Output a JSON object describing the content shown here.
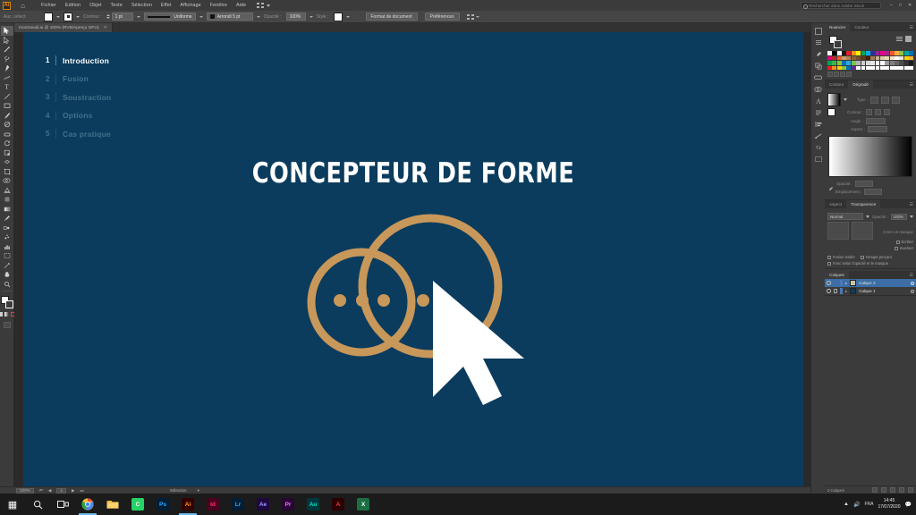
{
  "app": {
    "name": "Adobe Illustrator",
    "logo_text": "Ai"
  },
  "menubar": {
    "home_icon": "home-icon",
    "items": [
      "Fichier",
      "Edition",
      "Objet",
      "Texte",
      "Sélection",
      "Effet",
      "Affichage",
      "Fenêtre",
      "Aide"
    ],
    "arrange_icon": "grid-icon",
    "search_placeholder": "Rechercher dans Adobe Stock",
    "window_minimize": "–",
    "window_maximize": "□",
    "window_close": "✕"
  },
  "controlbar": {
    "selection_label": "Auc. sélect.",
    "fill_label": "fill-swatch",
    "stroke_label": "stroke-swatch",
    "stroke_name_label": "Contour :",
    "stroke_weight": "1 pt",
    "stroke_profile": "Uniforme",
    "brush_definition": "Arrondi 5 pt",
    "opacity_label": "Opacité :",
    "opacity_value": "100%",
    "style_label": "Style :",
    "document_setup": "Format de document",
    "preferences": "Préférences",
    "align_icon": "align-icon"
  },
  "document_tab": {
    "title": "montravail.ai @ 100% (RVB/Aperçu GPU)",
    "close_icon": "close-icon"
  },
  "toolbar": {
    "tools": [
      {
        "name": "selection-tool",
        "glyph": "➤",
        "selected": true
      },
      {
        "name": "direct-selection-tool",
        "glyph": "➤",
        "selected": false
      },
      {
        "name": "magic-wand-tool",
        "glyph": "✦",
        "selected": false
      },
      {
        "name": "lasso-tool",
        "glyph": "❀",
        "selected": false
      },
      {
        "name": "pen-tool",
        "glyph": "✒",
        "selected": false
      },
      {
        "name": "curvature-tool",
        "glyph": "∿",
        "selected": false
      },
      {
        "name": "type-tool",
        "glyph": "T",
        "selected": false
      },
      {
        "name": "line-segment-tool",
        "glyph": "╱",
        "selected": false
      },
      {
        "name": "rectangle-tool",
        "glyph": "□",
        "selected": false
      },
      {
        "name": "paintbrush-tool",
        "glyph": "✐",
        "selected": false
      },
      {
        "name": "shaper-tool",
        "glyph": "◔",
        "selected": false
      },
      {
        "name": "eraser-tool",
        "glyph": "▭",
        "selected": false
      },
      {
        "name": "rotate-tool",
        "glyph": "↻",
        "selected": false
      },
      {
        "name": "scale-tool",
        "glyph": "⤡",
        "selected": false
      },
      {
        "name": "width-tool",
        "glyph": "⦸",
        "selected": false
      },
      {
        "name": "free-transform-tool",
        "glyph": "▦",
        "selected": false
      },
      {
        "name": "shape-builder-tool",
        "glyph": "◍",
        "selected": false
      },
      {
        "name": "perspective-grid-tool",
        "glyph": "◱",
        "selected": false
      },
      {
        "name": "mesh-tool",
        "glyph": "⌗",
        "selected": false
      },
      {
        "name": "gradient-tool",
        "glyph": "▧",
        "selected": false
      },
      {
        "name": "eyedropper-tool",
        "glyph": "⚗",
        "selected": false
      },
      {
        "name": "blend-tool",
        "glyph": "⧉",
        "selected": false
      },
      {
        "name": "symbol-sprayer-tool",
        "glyph": "⁂",
        "selected": false
      },
      {
        "name": "column-graph-tool",
        "glyph": "█",
        "selected": false
      },
      {
        "name": "artboard-tool",
        "glyph": "⬚",
        "selected": false
      },
      {
        "name": "slice-tool",
        "glyph": "✄",
        "selected": false
      },
      {
        "name": "hand-tool",
        "glyph": "✋",
        "selected": false
      },
      {
        "name": "zoom-tool",
        "glyph": "⚲",
        "selected": false
      }
    ],
    "fill_color": "#ffffff",
    "stroke_color": "#ffffff"
  },
  "slide": {
    "background_color": "#0b3c5d",
    "accent_color": "#c8975a",
    "dim_color": "#44708c",
    "title": "CONCEPTEUR DE FORME",
    "outline": [
      {
        "number": "1",
        "label": "Introduction",
        "active": true
      },
      {
        "number": "2",
        "label": "Fusion",
        "active": false
      },
      {
        "number": "3",
        "label": "Soustraction",
        "active": false
      },
      {
        "number": "4",
        "label": "Options",
        "active": false
      },
      {
        "number": "5",
        "label": "Cas pratique",
        "active": false
      }
    ],
    "graphic_name": "shape-builder-illustration"
  },
  "statusbar": {
    "zoom": "100%",
    "artboard_nav_first": "⏮",
    "artboard_nav_prev": "◀",
    "artboard_number": "1",
    "artboard_nav_next": "▶",
    "artboard_nav_last": "⏭",
    "tool_status": "Sélection"
  },
  "rail": {
    "icons": [
      "properties-icon",
      "libraries-icon",
      "brushes-icon",
      "symbols-icon",
      "swatches-icon",
      "pathfinder-icon",
      "character-icon",
      "paragraph-icon",
      "align-icon",
      "transform-icon",
      "links-icon",
      "artboards-icon"
    ]
  },
  "panels": {
    "swatches": {
      "tabs": [
        "Nuancier",
        "Couleur"
      ],
      "active_tab": "Nuancier",
      "menu_icon": "panel-menu-icon",
      "list_view_icon": "list-view-icon",
      "grid_view_icon": "grid-view-icon",
      "row1": [
        "#ffffff",
        "#000000",
        "#ffffff",
        "#1a1a1a",
        "#ed1c24",
        "#f7941d",
        "#fff200",
        "#00a651",
        "#00aeef",
        "#2e3192",
        "#92278f",
        "#ec008c",
        "#a3238e",
        "#f15a29",
        "#fbb040",
        "#8dc63f",
        "#00a99d",
        "#0072bc"
      ],
      "row2": [
        "#e4007f",
        "#c1272d",
        "#f15a24",
        "#c69c6d",
        "#b58150",
        "#8c6239",
        "#754c24",
        "#603913",
        "#42210b",
        "#a67c52",
        "#c7b299",
        "#d9c9a3",
        "#e8d8b7",
        "#f2e6c8",
        "#ffffff",
        "#e6e6e6",
        "#ffd400",
        "#fbb03b"
      ],
      "row3": [
        "#00a651",
        "#39b54a",
        "#8cc63f",
        "#0071bc",
        "#29abe2",
        "#7ac943",
        "#b3b3b3",
        "#cccccc",
        "#d9d9d9",
        "#e6e6e6",
        "#f2f2f2",
        "#ffffff",
        "#999999",
        "#808080",
        "#666666",
        "#4d4d4d",
        "#333333",
        "#1a1a1a"
      ],
      "row4": [
        "#ed1c24",
        "#f7931e",
        "#ffcc00",
        "#8cc63f",
        "#0071bc",
        "#662d91",
        "#ffffff",
        "#ffffff",
        "#ffffff",
        "#ffffff",
        "#ffffff",
        "#ffffff",
        "#ffffff",
        "#ffffff",
        "#ffffff",
        "#ffffff",
        "#ffffff",
        "#ffffff"
      ]
    },
    "gradient": {
      "tabs": [
        "Contour",
        "Dégradé"
      ],
      "active_tab": "Dégradé",
      "type_label": "Type :",
      "contour_label": "Contour :",
      "angle_label": "Angle :",
      "aspect_label": "Aspect :",
      "opacity_label": "Opacité :",
      "position_label": "Emplacement :",
      "opacity_value": "",
      "position_value": "",
      "gradient_start": "#ffffff",
      "gradient_end": "#000000"
    },
    "transparency": {
      "tabs": [
        "Aspect",
        "Transparence"
      ],
      "active_tab": "Transparence",
      "blend_mode": "Normal",
      "opacity_label": "Opacité :",
      "opacity_value": "100%",
      "make_mask_label": "Créer un masque",
      "clip_label": "Ecrêter",
      "invert_label": "Inverser",
      "checkbox_isolate": "Fusion isolée",
      "checkbox_knockout": "Groupe perçant",
      "checkbox_opacity_mask": "Fonc selon l'opacité et le masque"
    },
    "layers": {
      "tabs": [
        "Calques"
      ],
      "active_tab": "Calques",
      "rows": [
        {
          "name": "Calque 2",
          "thumb_color": "#c8c3ae",
          "selected": true,
          "locked": false
        },
        {
          "name": "Calque 1",
          "thumb_color": "#0b3c5d",
          "selected": false,
          "locked": true
        }
      ],
      "footer_count": "2 Calques"
    }
  },
  "taskbar": {
    "items": [
      {
        "name": "start-button",
        "label": "⊞",
        "color": "#1b1b1b",
        "text": "",
        "active": false
      },
      {
        "name": "search-button",
        "label": "⚲",
        "color": "#1b1b1b",
        "text": "",
        "active": false
      },
      {
        "name": "task-view-button",
        "label": "❐",
        "color": "#1b1b1b",
        "text": "",
        "active": false
      },
      {
        "name": "chrome-app",
        "label": "",
        "color": "#e8453c",
        "text": "",
        "active": true
      },
      {
        "name": "file-explorer-app",
        "label": "",
        "color": "#f5b940",
        "text": "",
        "active": false
      },
      {
        "name": "messaging-app",
        "label": "",
        "color": "#25d366",
        "text": "C",
        "active": false
      },
      {
        "name": "photoshop-app",
        "label": "Ps",
        "color": "#001e36",
        "text": "Ps",
        "active": false
      },
      {
        "name": "illustrator-app",
        "label": "Ai",
        "color": "#ff9a00",
        "text": "Ai",
        "active": true
      },
      {
        "name": "indesign-app",
        "label": "Id",
        "color": "#49021f",
        "text": "Id",
        "active": false
      },
      {
        "name": "lightroom-app",
        "label": "Lr",
        "color": "#001e36",
        "text": "Lr",
        "active": false
      },
      {
        "name": "after-effects-app",
        "label": "Ae",
        "color": "#1f0740",
        "text": "Ae",
        "active": false
      },
      {
        "name": "premiere-app",
        "label": "Pr",
        "color": "#2a0634",
        "text": "Pr",
        "active": false
      },
      {
        "name": "audition-app",
        "label": "Au",
        "color": "#00363d",
        "text": "Au",
        "active": false
      },
      {
        "name": "acrobat-app",
        "label": "",
        "color": "#b30b00",
        "text": "A",
        "active": false
      },
      {
        "name": "excel-app",
        "label": "",
        "color": "#1d6f42",
        "text": "X",
        "active": false
      }
    ],
    "tray": {
      "network_icon": "network-icon",
      "volume_icon": "volume-icon",
      "language": "FRA",
      "time": "14:45",
      "date": "17/07/2020",
      "notifications_icon": "notifications-icon"
    }
  }
}
